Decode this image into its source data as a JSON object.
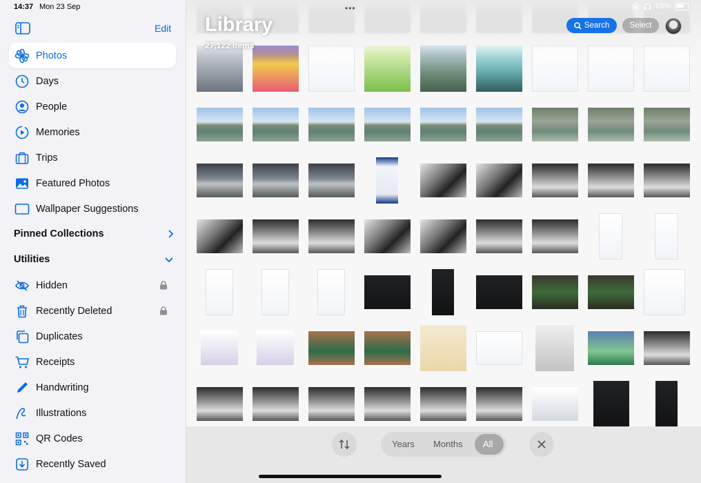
{
  "status": {
    "time": "14:37",
    "date": "Mon 23 Sep",
    "battery": "65%"
  },
  "sidebar": {
    "edit_label": "Edit",
    "items": [
      {
        "label": "Photos",
        "icon": "photos-icon",
        "selected": true
      },
      {
        "label": "Days",
        "icon": "days-icon"
      },
      {
        "label": "People",
        "icon": "people-icon"
      },
      {
        "label": "Memories",
        "icon": "memories-icon"
      },
      {
        "label": "Trips",
        "icon": "trips-icon"
      },
      {
        "label": "Featured Photos",
        "icon": "featured-photos-icon"
      },
      {
        "label": "Wallpaper Suggestions",
        "icon": "wallpaper-icon"
      }
    ],
    "pinned_label": "Pinned Collections",
    "utilities_label": "Utilities",
    "utilities": [
      {
        "label": "Hidden",
        "icon": "hidden-icon",
        "locked": true
      },
      {
        "label": "Recently Deleted",
        "icon": "trash-icon",
        "locked": true
      },
      {
        "label": "Duplicates",
        "icon": "duplicates-icon"
      },
      {
        "label": "Receipts",
        "icon": "cart-icon"
      },
      {
        "label": "Handwriting",
        "icon": "pencil-icon"
      },
      {
        "label": "Illustrations",
        "icon": "illustrations-icon"
      },
      {
        "label": "QR Codes",
        "icon": "qr-code-icon"
      },
      {
        "label": "Recently Saved",
        "icon": "recently-saved-icon"
      }
    ]
  },
  "main": {
    "title": "Library",
    "count": "27,122 Items",
    "search_label": "Search",
    "select_label": "Select"
  },
  "view_switcher": {
    "years": "Years",
    "months": "Months",
    "all": "All",
    "selected": "All"
  }
}
